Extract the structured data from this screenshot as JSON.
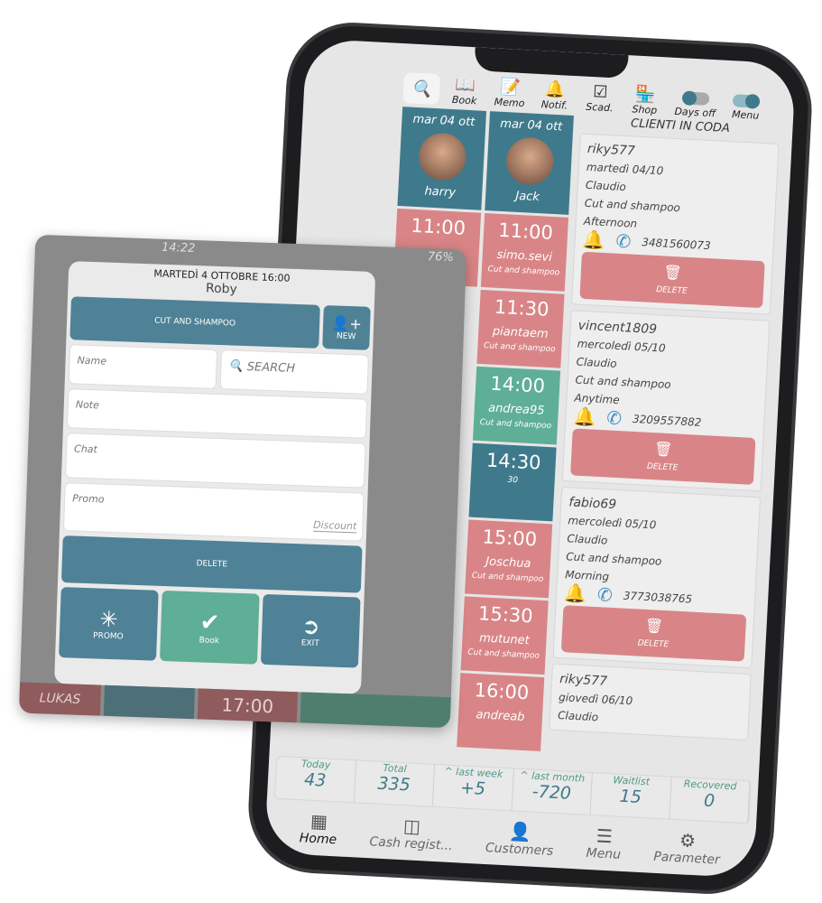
{
  "toolbar": {
    "items": [
      {
        "label": "Book",
        "icon": "book-icon"
      },
      {
        "label": "Memo",
        "icon": "memo-icon"
      },
      {
        "label": "Notif.",
        "icon": "bell-icon"
      },
      {
        "label": "Scad.",
        "icon": "checklist-icon"
      },
      {
        "label": "Shop",
        "icon": "shop-icon"
      }
    ],
    "days_off": "Days off",
    "menu": "Menu"
  },
  "calendar": {
    "columns": [
      {
        "date": "mar 04 ott",
        "staff": "harry",
        "slots": [
          {
            "time": "11:00",
            "name": "",
            "service": "",
            "color": "#d98587"
          },
          {
            "time": "",
            "name": "LUKAS",
            "service": "Cut and shampoo",
            "color": "#d98587"
          },
          {
            "time": "17:00",
            "name": "",
            "service": "",
            "color": "#d98587"
          }
        ]
      },
      {
        "date": "mar 04 ott",
        "staff": "Jack",
        "slots": [
          {
            "time": "11:00",
            "name": "simo.sevi",
            "service": "Cut and shampoo",
            "color": "#d98587"
          },
          {
            "time": "11:30",
            "name": "piantaem",
            "service": "Cut and shampoo",
            "color": "#d98587"
          },
          {
            "time": "14:00",
            "name": "andrea95",
            "service": "Cut and shampoo",
            "color": "#5fae96"
          },
          {
            "time": "14:30",
            "name": "30",
            "service": "",
            "color": "#3f7a8c"
          },
          {
            "time": "15:00",
            "name": "Joschua",
            "service": "Cut and shampoo",
            "color": "#d98587"
          },
          {
            "time": "15:30",
            "name": "mutunet",
            "service": "Cut and shampoo",
            "color": "#d98587"
          },
          {
            "time": "16:00",
            "name": "andreab",
            "service": "",
            "color": "#d98587"
          }
        ]
      }
    ]
  },
  "queue": {
    "title": "CLIENTI IN CODA",
    "delete": "DELETE",
    "cards": [
      {
        "user": "riky577",
        "date": "martedì 04/10",
        "staff": "Claudio",
        "service": "Cut and shampoo",
        "time": "Afternoon",
        "phone": "3481560073"
      },
      {
        "user": "vincent1809",
        "date": "mercoledì 05/10",
        "staff": "Claudio",
        "service": "Cut and shampoo",
        "time": "Anytime",
        "phone": "3209557882"
      },
      {
        "user": "fabio69",
        "date": "mercoledì 05/10",
        "staff": "Claudio",
        "service": "Cut and shampoo",
        "time": "Morning",
        "phone": "3773038765"
      },
      {
        "user": "riky577",
        "date": "giovedì 06/10",
        "staff": "Claudio",
        "service": "",
        "time": "",
        "phone": ""
      }
    ]
  },
  "stats": [
    {
      "label": "Today",
      "value": "43"
    },
    {
      "label": "Total",
      "value": "335"
    },
    {
      "label": "^ last week",
      "value": "+5"
    },
    {
      "label": "^ last month",
      "value": "-720"
    },
    {
      "label": "Waitlist",
      "value": "15"
    },
    {
      "label": "Recovered",
      "value": "0"
    }
  ],
  "nav": [
    {
      "label": "Home",
      "icon": "grid-icon"
    },
    {
      "label": "Cash regist...",
      "icon": "cash-register-icon"
    },
    {
      "label": "Customers",
      "icon": "user-icon"
    },
    {
      "label": "Menu",
      "icon": "menu-icon"
    },
    {
      "label": "Parameter",
      "icon": "gear-icon"
    }
  ],
  "dialog": {
    "status_time": "14:22",
    "battery": "76%",
    "header": "MARTEDÌ 4 OTTOBRE 16:00",
    "staff": "Roby",
    "service": "CUT AND SHAMPOO",
    "new": "NEW",
    "name_placeholder": "Name",
    "search_placeholder": "SEARCH",
    "note_placeholder": "Note",
    "chat_placeholder": "Chat",
    "promo_placeholder": "Promo",
    "discount_placeholder": "Discount",
    "delete": "DELETE",
    "promo": "PROMO",
    "book": "Book",
    "exit": "EXIT"
  },
  "colors": {
    "teal": "#3f7a8c",
    "pink": "#d98587",
    "green": "#5fae96"
  }
}
